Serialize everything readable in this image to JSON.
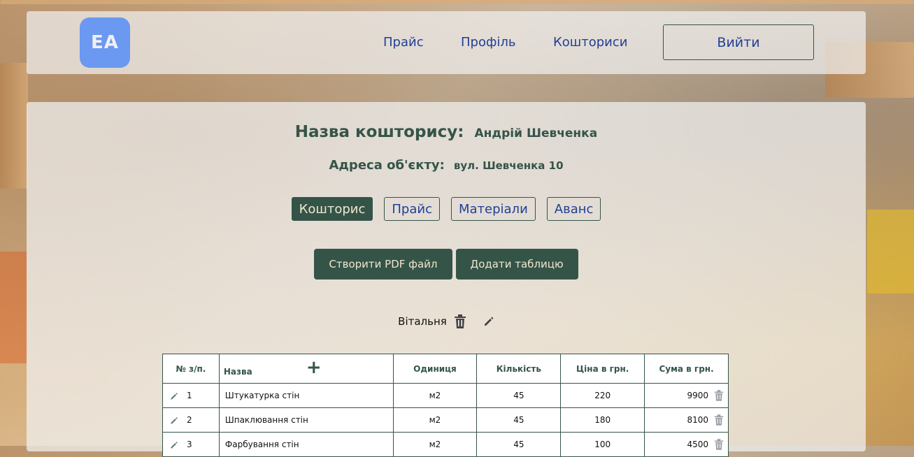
{
  "header": {
    "logo_text": "EA",
    "nav": {
      "price": "Прайс",
      "profile": "Профіль",
      "estimates": "Кошториси"
    },
    "logout_label": "Вийти"
  },
  "estimate": {
    "name_label": "Назва кошторису:",
    "name_value": "Андрій Шевченка",
    "address_label": "Адреса об'єкту:",
    "address_value": "вул. Шевченка 10"
  },
  "tabs": [
    {
      "label": "Кошторис",
      "active": true
    },
    {
      "label": "Прайс",
      "active": false
    },
    {
      "label": "Матеріали",
      "active": false
    },
    {
      "label": "Аванс",
      "active": false
    }
  ],
  "actions": {
    "create_pdf": "Створити PDF файл",
    "add_table": "Додати таблицю"
  },
  "room": {
    "title": "Вітальня"
  },
  "table": {
    "headers": [
      "№ з/п.",
      "Назва",
      "Одиниця",
      "Кількість",
      "Ціна в грн.",
      "Сума в грн."
    ],
    "rows": [
      {
        "num": "1",
        "name": "Штукатурка стін",
        "unit": "м2",
        "qty": "45",
        "price": "220",
        "sum": "9900"
      },
      {
        "num": "2",
        "name": "Шпаклювання стін",
        "unit": "м2",
        "qty": "45",
        "price": "180",
        "sum": "8100"
      },
      {
        "num": "3",
        "name": "Фарбування стін",
        "unit": "м2",
        "qty": "45",
        "price": "100",
        "sum": "4500"
      }
    ]
  },
  "icons": {
    "edit": "pencil-icon",
    "delete": "trash-icon",
    "add": "plus-icon"
  },
  "colors": {
    "primary": "#355448",
    "link": "#223f96",
    "logo": "#6b98f0",
    "delete_icon": "#9aa0a6"
  }
}
